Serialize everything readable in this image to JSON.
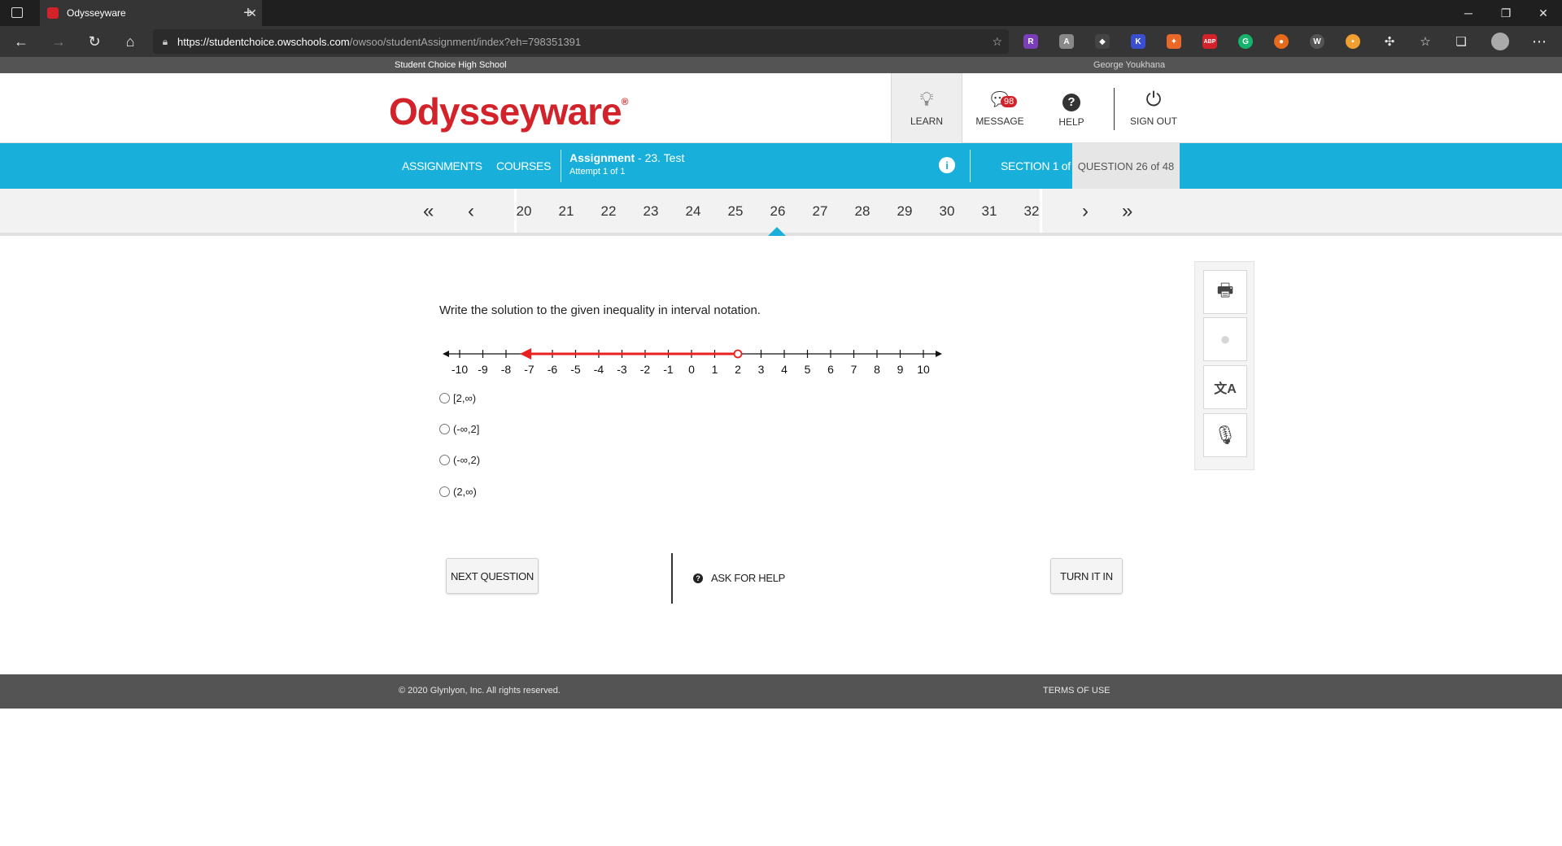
{
  "browser": {
    "tab_title": "Odysseyware",
    "url_host": "https://studentchoice.owschools.com",
    "url_path": "/owsoo/studentAssignment/index?eh=798351391"
  },
  "site": {
    "school_name": "Student Choice High School",
    "user_name": "George Youkhana",
    "logo_text": "Odysseyware",
    "logo_mark": "®"
  },
  "header_nav": {
    "learn": "LEARN",
    "message": "MESSAGE",
    "message_count": "98",
    "help": "HELP",
    "sign_out": "SIGN OUT"
  },
  "bluebar": {
    "assignments": "ASSIGNMENTS",
    "courses": "COURSES",
    "assignment_label": "Assignment",
    "assignment_name": " - 23. Test",
    "attempt": "Attempt 1 of 1",
    "section": "SECTION 1 of 1",
    "question_pos": "QUESTION 26 of 48"
  },
  "pager": {
    "numbers": [
      "20",
      "21",
      "22",
      "23",
      "24",
      "25",
      "26",
      "27",
      "28",
      "29",
      "30",
      "31",
      "32"
    ],
    "current": "26"
  },
  "question": {
    "prompt": "Write the solution to the given inequality in interval notation.",
    "number_line": {
      "min": -10,
      "max": 10,
      "tick_labels": [
        "-10",
        "-9",
        "-8",
        "-7",
        "-6",
        "-5",
        "-4",
        "-3",
        "-2",
        "-1",
        "0",
        "1",
        "2",
        "3",
        "4",
        "5",
        "6",
        "7",
        "8",
        "9",
        "10"
      ],
      "ray_from": 2,
      "ray_direction": "left",
      "endpoint": "open",
      "ray_color": "#e8201f"
    },
    "options": [
      "[2,∞)",
      "(-∞,2]",
      "(-∞,2)",
      "(2,∞)"
    ]
  },
  "actions": {
    "next": "NEXT QUESTION",
    "ask_help": "ASK FOR HELP",
    "turn_in": "TURN IT IN"
  },
  "footer": {
    "copyright": "© 2020 Glynlyon, Inc. All rights reserved.",
    "terms": "TERMS OF USE"
  },
  "colors": {
    "brand_red": "#d2232a",
    "accent_blue": "#18b0da"
  }
}
